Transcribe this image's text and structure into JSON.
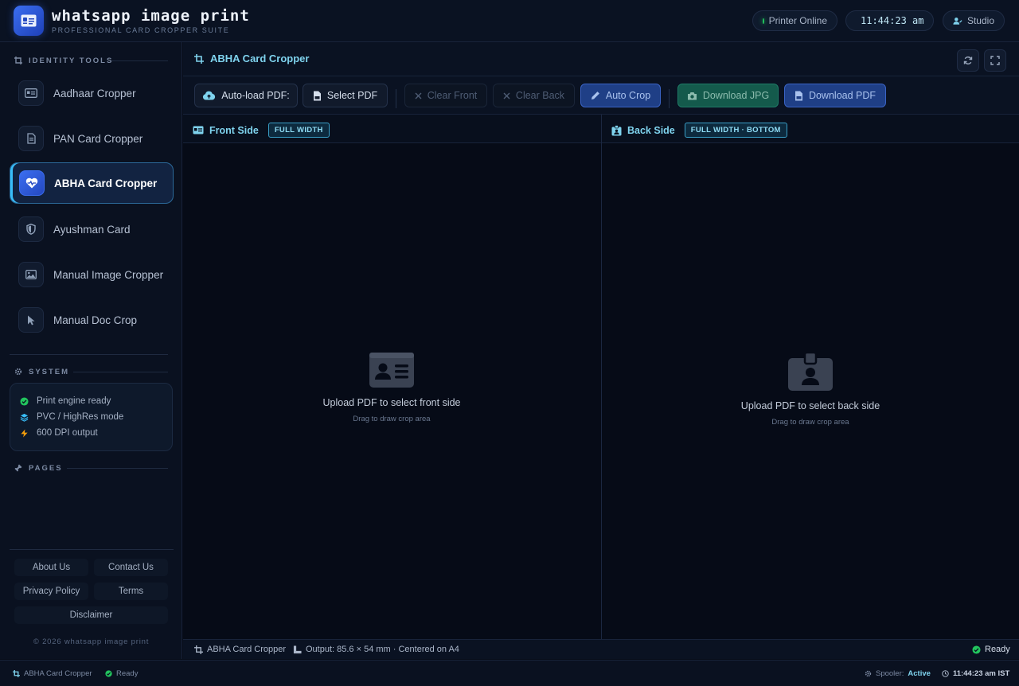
{
  "header": {
    "brand_title": "whatsapp image print",
    "brand_subtitle": "PROFESSIONAL CARD CROPPER SUITE",
    "printer_status": "Printer Online",
    "clock": "11:44:23 am",
    "studio_label": "Studio"
  },
  "sidebar": {
    "identity_heading": "IDENTITY TOOLS",
    "items": [
      {
        "label": "Aadhaar Cropper",
        "icon": "id-card-icon"
      },
      {
        "label": "PAN Card Cropper",
        "icon": "document-icon"
      },
      {
        "label": "ABHA Card Cropper",
        "icon": "heart-pulse-icon",
        "active": true
      },
      {
        "label": "Ayushman Card",
        "icon": "shield-icon"
      },
      {
        "label": "Manual Image Cropper",
        "icon": "image-icon"
      },
      {
        "label": "Manual Doc Crop",
        "icon": "pointer-icon"
      }
    ],
    "system_heading": "SYSTEM",
    "system_items": [
      {
        "label": "Print engine ready",
        "icon": "check-circle-icon"
      },
      {
        "label": "PVC / HighRes mode",
        "icon": "layers-icon"
      },
      {
        "label": "600 DPI output",
        "icon": "bolt-icon"
      }
    ],
    "pages_heading": "PAGES",
    "footer_links": {
      "about": "About Us",
      "contact": "Contact Us",
      "privacy": "Privacy Policy",
      "terms": "Terms",
      "disclaimer": "Disclaimer"
    },
    "copyright": "© 2026 whatsapp image print"
  },
  "main": {
    "title": "ABHA Card Cropper",
    "toolbar": {
      "autoload": "Auto-load PDF:",
      "select_pdf": "Select PDF",
      "clear_front": "Clear Front",
      "clear_back": "Clear Back",
      "auto_crop": "Auto Crop",
      "download_jpg": "Download JPG",
      "download_pdf": "Download PDF"
    },
    "front": {
      "title": "Front Side",
      "badge": "FULL WIDTH",
      "placeholder": "Upload PDF to select front side",
      "hint": "Drag to draw crop area"
    },
    "back": {
      "title": "Back Side",
      "badge": "FULL WIDTH · BOTTOM",
      "placeholder": "Upload PDF to select back side",
      "hint": "Drag to draw crop area"
    },
    "status": {
      "tool": "ABHA Card Cropper",
      "output": "Output: 85.6 × 54 mm · Centered on A4",
      "state": "Ready"
    }
  },
  "footer": {
    "tool": "ABHA Card Cropper",
    "state": "Ready",
    "spooler_label": "Spooler:",
    "spooler_value": "Active",
    "clock": "11:44:23 am IST"
  },
  "colors": {
    "accent_cyan": "#7fd3ee",
    "accent_blue": "#3b6ef0",
    "success_green": "#22c55e",
    "background": "#060b17"
  }
}
